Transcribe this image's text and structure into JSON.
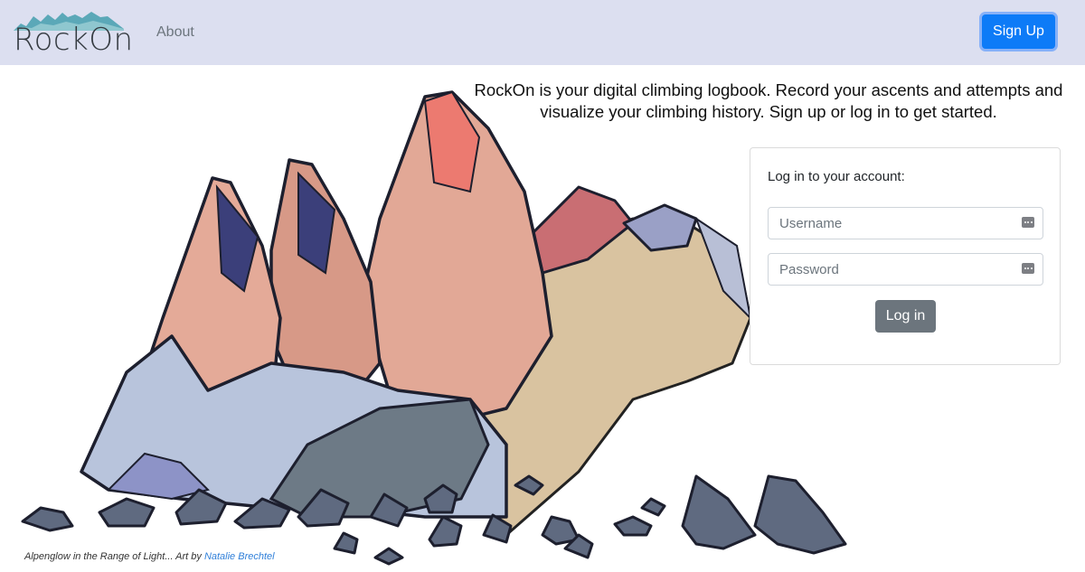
{
  "brand": {
    "name": "RockOn"
  },
  "nav": {
    "about_label": "About",
    "signup_label": "Sign Up"
  },
  "intro": {
    "text": "RockOn is your digital climbing logbook. Record your ascents and attempts and visualize your climbing history. Sign up or log in to get started."
  },
  "login": {
    "title": "Log in to your account:",
    "username_placeholder": "Username",
    "password_placeholder": "Password",
    "submit_label": "Log in"
  },
  "caption": {
    "title": "Alpenglow in the Range of Light... Art by ",
    "artist": "Natalie Brechtel"
  },
  "colors": {
    "navbar_bg": "#dcdff0",
    "primary": "#0d7bf7",
    "secondary": "#6c757d",
    "link": "#2f7fd9"
  },
  "icons": {
    "brand": "mountain-logo-icon",
    "field_autofill": "keychain-icon"
  }
}
